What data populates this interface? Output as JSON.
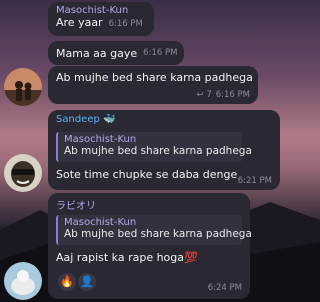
{
  "messages": [
    {
      "sender": "Masochist-Kun",
      "text": "Are yaar",
      "time": "6:16 PM"
    },
    {
      "text": "Mama aa gaye",
      "time": "6:16 PM"
    },
    {
      "text": "Ab mujhe bed share karna padhega",
      "meta": "↩ 7",
      "time": "6:16 PM"
    },
    {
      "sender": "Sandeep",
      "sender_emoji": "🐳",
      "quote_sender": "Masochist-Kun",
      "quote_text": "Ab mujhe bed share karna padhega",
      "text": "Sote time chupke se daba denge",
      "time": "6:21 PM"
    },
    {
      "sender": "ラビオリ",
      "quote_sender": "Masochist-Kun",
      "quote_text": "Ab mujhe bed share karna padhega",
      "text": "Aaj rapist ka rape hoga💯",
      "reactions": [
        "🔥",
        "👤"
      ],
      "time": "6:24 PM"
    }
  ],
  "icons": [
    "forward-icon",
    "fire-reaction-icon",
    "user-reaction-icon"
  ]
}
